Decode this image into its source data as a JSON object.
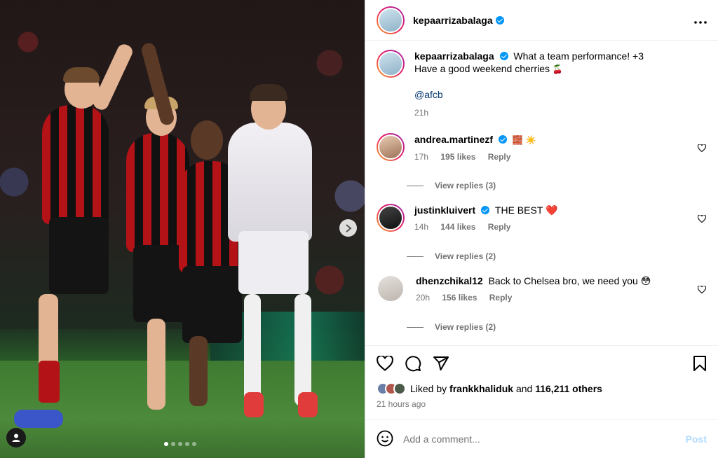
{
  "post": {
    "author": "kepaarrizabalaga",
    "more_icon": "more-horizontal-icon",
    "caption_line1": "What a team performance! +3",
    "caption_line2": "Have a good weekend cherries",
    "caption_emoji": "🍒",
    "mention": "@afcb",
    "caption_time": "21h"
  },
  "comments": [
    {
      "user": "andrea.martinezf",
      "verified": true,
      "text": "🧱 ☀️",
      "time": "17h",
      "likes": "195 likes",
      "reply": "Reply",
      "view_replies": "View replies (3)"
    },
    {
      "user": "justinkluivert",
      "verified": true,
      "text": "THE BEST ❤️",
      "time": "14h",
      "likes": "144 likes",
      "reply": "Reply",
      "view_replies": "View replies (2)"
    },
    {
      "user": "dhenzchikal12",
      "verified": false,
      "text": "Back to Chelsea bro, we need you 😳",
      "time": "20h",
      "likes": "156 likes",
      "reply": "Reply",
      "view_replies": "View replies (2)"
    }
  ],
  "actions": {
    "like_icon": "heart-icon",
    "comment_icon": "comment-icon",
    "share_icon": "share-icon",
    "save_icon": "bookmark-icon"
  },
  "likes": {
    "prefix": "Liked by",
    "user": "frankkhaliduk",
    "joiner": "and",
    "count": "116,211 others",
    "time_ago": "21 hours ago"
  },
  "add_comment": {
    "placeholder": "Add a comment...",
    "post_label": "Post"
  },
  "carousel": {
    "slides": 5,
    "current": 1
  },
  "colors": {
    "accent": "#0095f6",
    "link": "#00376b",
    "muted": "#737373",
    "like_red": "#ed4956"
  }
}
